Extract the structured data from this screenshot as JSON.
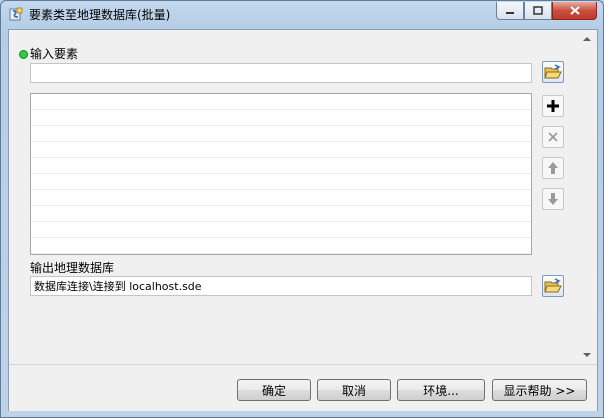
{
  "window": {
    "title": "要素类至地理数据库(批量)"
  },
  "form": {
    "input_features_label": "输入要素",
    "input_features_value": "",
    "list_items": [
      "",
      "",
      "",
      "",
      "",
      "",
      "",
      "",
      "",
      ""
    ],
    "output_gdb_label": "输出地理数据库",
    "output_gdb_value": "数据库连接\\连接到 localhost.sde"
  },
  "icons": {
    "app": "toolbox-script-icon",
    "browse": "open-folder-icon",
    "add": "plus-icon",
    "remove": "x-icon",
    "move_up": "arrow-up-icon",
    "move_down": "arrow-down-icon"
  },
  "buttons": {
    "ok": "确定",
    "cancel": "取消",
    "environments": "环境...",
    "show_help": "显示帮助 >>"
  },
  "colors": {
    "required_dot": "#2ecc40",
    "close_button": "#c8513c"
  }
}
